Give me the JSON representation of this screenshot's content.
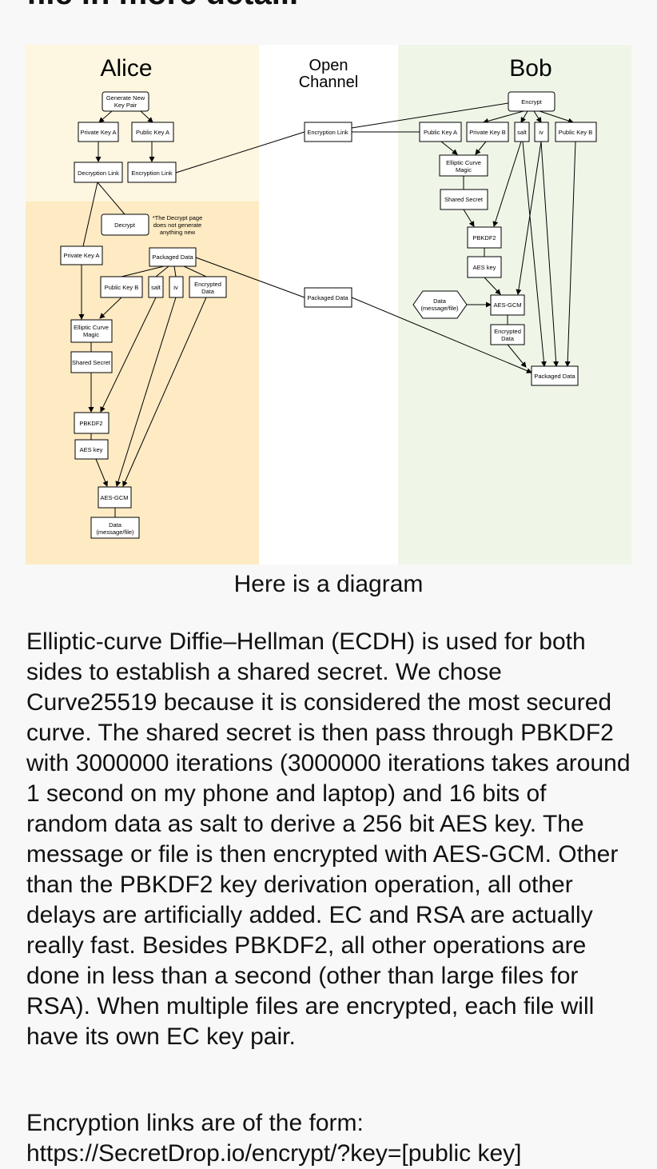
{
  "heading": {
    "fragment": "file in more detail."
  },
  "diagram": {
    "lanes": {
      "alice": "Alice",
      "channel": [
        "Open",
        "Channel"
      ],
      "bob": "Bob"
    },
    "alice": {
      "generate_key_pair": [
        "Generate New",
        "Key Pair"
      ],
      "private_key_a": "Private Key A",
      "public_key_a": "Public Key A",
      "decryption_link": "Decryption Link",
      "encryption_link": "Encryption Link",
      "decrypt": "Decrypt",
      "decrypt_note": [
        "*The Decrypt page",
        "does not generate",
        "anything new"
      ],
      "private_key_a_2": "Private Key A",
      "packaged_data": "Packaged Data",
      "public_key_b": "Public Key B",
      "salt": "salt",
      "iv": "iv",
      "encrypted_data": [
        "Encrypted",
        "Data"
      ],
      "elliptic_curve_magic": [
        "Elliptic Curve",
        "Magic"
      ],
      "shared_secret": "Shared Secret",
      "pbkdf2": "PBKDF2",
      "aes_key": "AES key",
      "aes_gcm": "AES-GCM",
      "data": [
        "Data",
        "(message/file)"
      ]
    },
    "channel": {
      "encryption_link": "Encryption Link",
      "packaged_data": "Packaged Data"
    },
    "bob": {
      "encrypt": "Encrypt",
      "public_key_a": "Public Key A",
      "private_key_b": "Private Key B",
      "salt": "salt",
      "iv": "iv",
      "public_key_b": "Public Key B",
      "elliptic_curve_magic": [
        "Elliptic Curve",
        "Magic"
      ],
      "shared_secret": "Shared Secret",
      "pbkdf2": "PBKDF2",
      "aes_key": "AES key",
      "data": [
        "Data",
        "(message/file)"
      ],
      "aes_gcm": "AES-GCM",
      "encrypted_data": [
        "Encrypted",
        "Data"
      ],
      "packaged_data": "Packaged Data"
    },
    "colors": {
      "alice_top": "#fdf6e0",
      "alice_bottom": "#feebc3",
      "channel": "#ffffff",
      "bob": "#eff6e8",
      "node_fill": "#ffffff",
      "stroke": "#000000"
    }
  },
  "caption": "Here is a diagram",
  "paragraph": "Elliptic-curve Diffie–Hellman (ECDH) is used for both sides to establish a shared secret. We chose Curve25519 because it is considered the most secured curve. The shared secret is then pass through PBKDF2 with 3000000 iterations (3000000 iterations takes around 1 second on my phone and laptop) and 16 bits of random data as salt to derive a 256 bit AES key. The message or file is then encrypted with AES-GCM. Other than the PBKDF2 key derivation operation, all other delays are artificially added. EC and RSA are actually really fast. Besides PBKDF2, all other operations are done in less than a second (other than large files for RSA). When multiple files are encrypted, each file will have its own EC key pair.",
  "links": {
    "intro": "Encryption links are of the form:",
    "url": "https://SecretDrop.io/encrypt/?key=[public key]"
  }
}
